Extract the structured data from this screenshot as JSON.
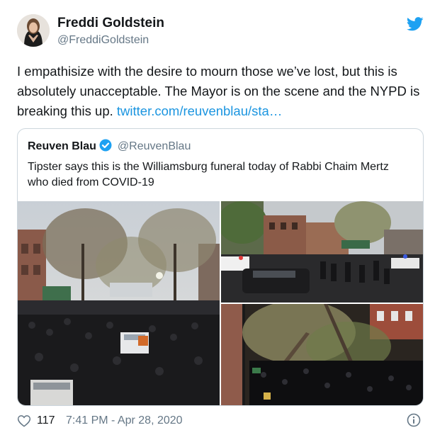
{
  "tweet": {
    "author_name": "Freddi Goldstein",
    "author_handle": "@FreddiGoldstein",
    "text": "I empathisize with the desire to mourn those we’ve lost, but this is absolutely unacceptable. The Mayor is on the scene and the NYPD is breaking this up. ",
    "link_text": "twitter.com/reuvenblau/sta…",
    "likes": "117",
    "timestamp": "7:41 PM - Apr 28, 2020"
  },
  "quoted": {
    "author_name": "Reuven Blau",
    "author_handle": "@ReuvenBlau",
    "text": "Tipster says this is the Williamsburg funeral today of Rabbi Chaim Mertz who died from COVID-19"
  },
  "icons": {
    "brand": "twitter-bird-icon",
    "verified": "verified-badge-icon",
    "like": "heart-icon",
    "info": "info-icon"
  },
  "colors": {
    "link": "#1b95e0",
    "twitter_blue": "#1da1f2",
    "secondary_text": "#657786",
    "border": "#ccd6dd"
  }
}
